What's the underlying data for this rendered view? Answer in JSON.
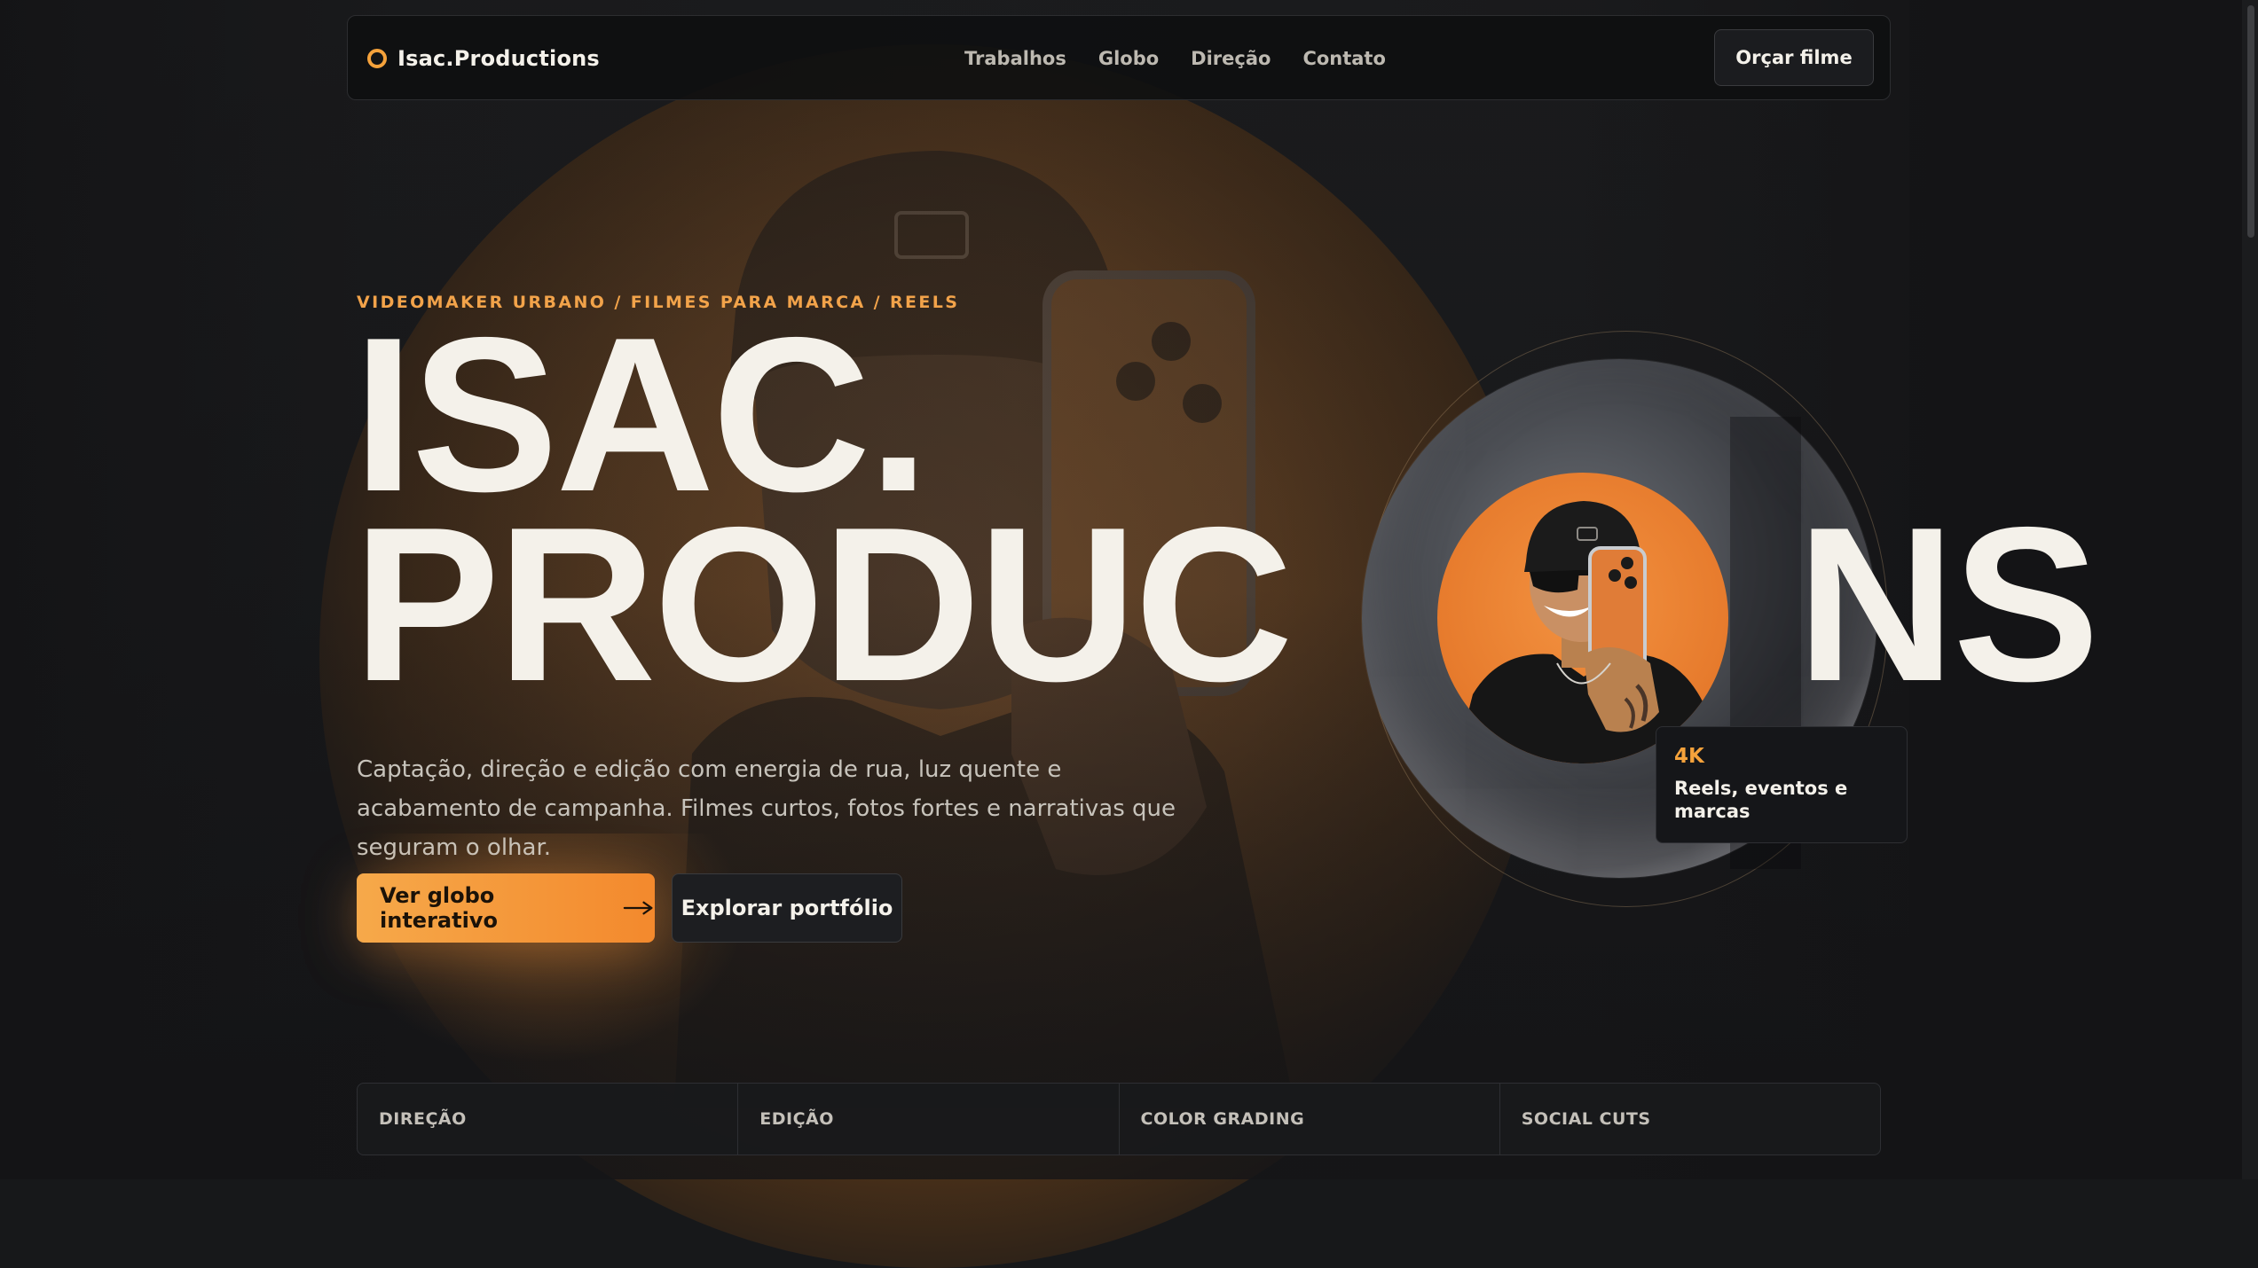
{
  "navbar": {
    "brand": "Isac.Productions",
    "links": [
      "Trabalhos",
      "Globo",
      "Direção",
      "Contato"
    ],
    "cta": "Orçar filme"
  },
  "hero": {
    "eyebrow": "VIDEOMAKER URBANO / FILMES PARA MARCA / REELS",
    "headline_line1": "ISAC.",
    "headline_line2": "PRODUC",
    "headline_line2_end": "NS",
    "intro": "Captação, direção e edição com energia de rua, luz quente e acabamento de campanha. Filmes curtos, fotos fortes e narrativas que seguram o olhar.",
    "primary_button": "Ver globo interativo",
    "secondary_button": "Explorar portfólio"
  },
  "stat_card": {
    "value": "4K",
    "label": "Reels, eventos e marcas"
  },
  "services": [
    "DIREÇÃO",
    "EDIÇÃO",
    "COLOR GRADING",
    "SOCIAL CUTS"
  ],
  "icons": {
    "brand": "ring-logo-icon",
    "primary_button": "arrow-right-icon"
  },
  "colors": {
    "accent": "#f5a23b",
    "background": "#17181a",
    "text": "#f4f1ea"
  }
}
